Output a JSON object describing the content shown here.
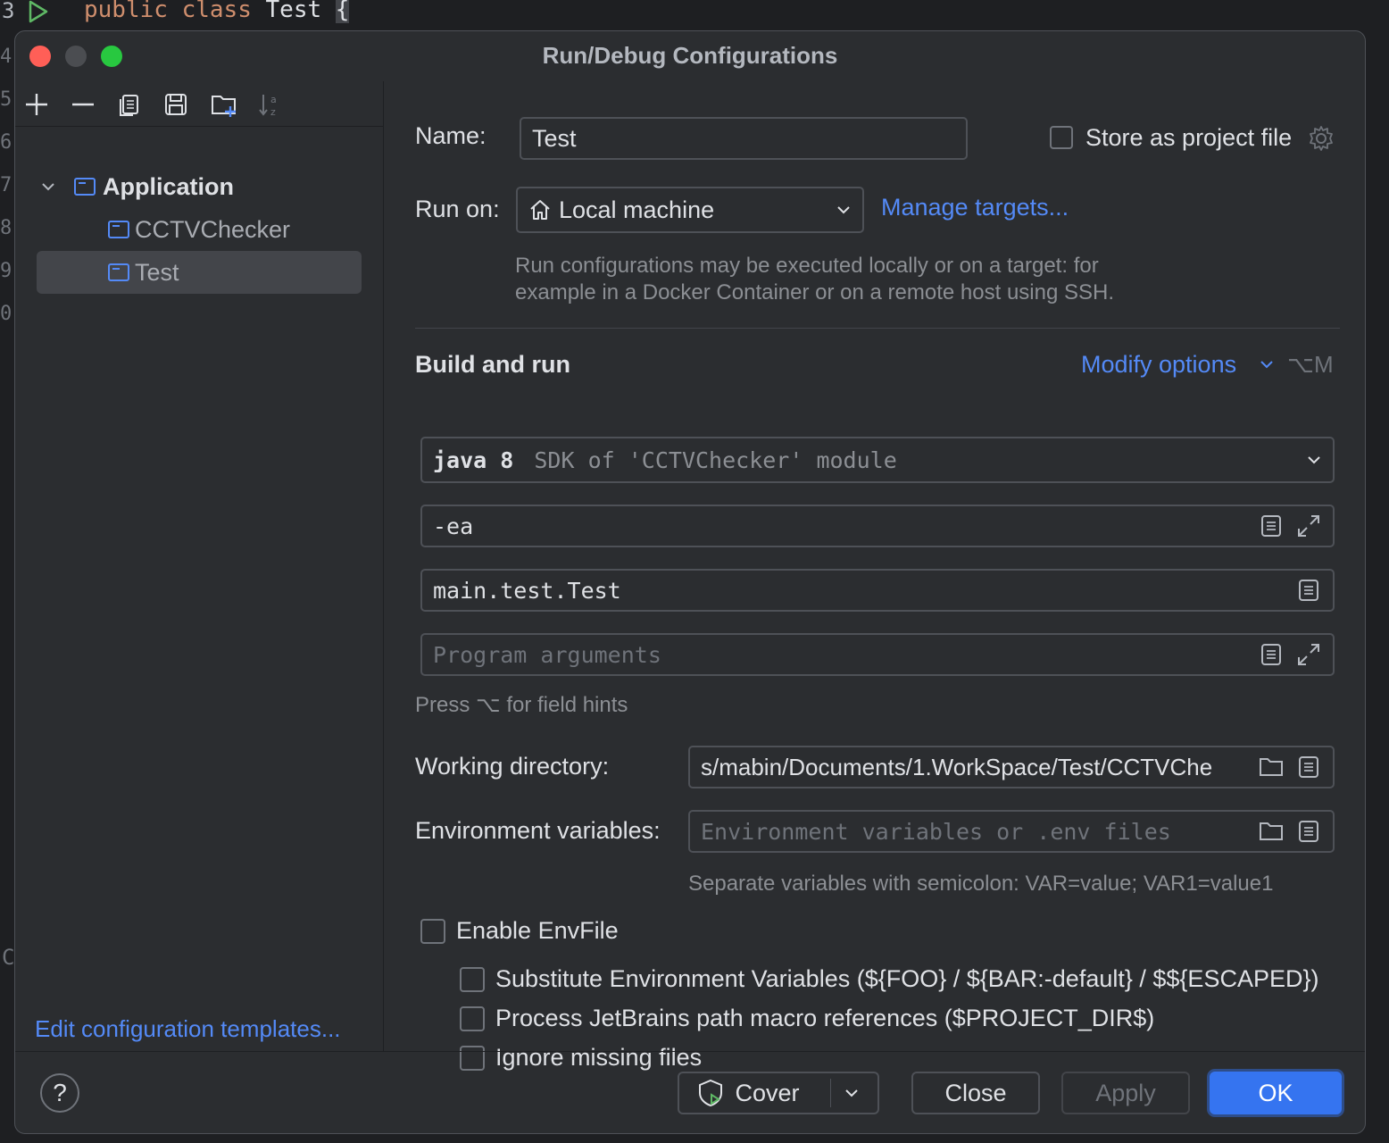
{
  "editor": {
    "line_number": "3",
    "code_keyword1": "public",
    "code_keyword2": "class",
    "code_name": "Test",
    "code_brace": "{",
    "gutter_numbers": [
      "4",
      "5",
      "6",
      "7",
      "8",
      "9",
      "0"
    ],
    "side_char": "C"
  },
  "dialog": {
    "title": "Run/Debug Configurations"
  },
  "tree": {
    "group": "Application",
    "items": [
      {
        "label": "CCTVChecker",
        "selected": false
      },
      {
        "label": "Test",
        "selected": true
      }
    ],
    "edit_templates": "Edit configuration templates..."
  },
  "form": {
    "name_label": "Name:",
    "name_value": "Test",
    "store_label": "Store as project file",
    "run_on_label": "Run on:",
    "run_on_value": "Local machine",
    "manage_targets": "Manage targets...",
    "run_on_hint_1": "Run configurations may be executed locally or on a target: for",
    "run_on_hint_2": "example in a Docker Container or on a remote host using SSH.",
    "build_run_title": "Build and run",
    "modify_options": "Modify options",
    "modify_shortcut": "⌥M",
    "sdk_main": "java 8",
    "sdk_detail": "SDK of 'CCTVChecker' module",
    "vm_options": "-ea",
    "main_class": "main.test.Test",
    "program_args_placeholder": "Program arguments",
    "field_hints": "Press ⌥ for field hints",
    "working_dir_label": "Working directory:",
    "working_dir_value": "s/mabin/Documents/1.WorkSpace/Test/CCTVChe",
    "env_label": "Environment variables:",
    "env_placeholder": "Environment variables or .env files",
    "env_hint": "Separate variables with semicolon: VAR=value; VAR1=value1",
    "enable_envfile": "Enable EnvFile",
    "substitute": "Substitute Environment Variables (${FOO} / ${BAR:-default} / $${ESCAPED})",
    "process_macros": "Process JetBrains path macro references ($PROJECT_DIR$)",
    "ignore_missing": "Ignore missing files"
  },
  "footer": {
    "help": "?",
    "cover": "Cover",
    "close": "Close",
    "apply": "Apply",
    "ok": "OK"
  },
  "colors": {
    "accent": "#3574f0",
    "link": "#548af7",
    "dialog_bg": "#2b2d30",
    "close_dot": "#ff5f57",
    "max_dot": "#28c840"
  }
}
